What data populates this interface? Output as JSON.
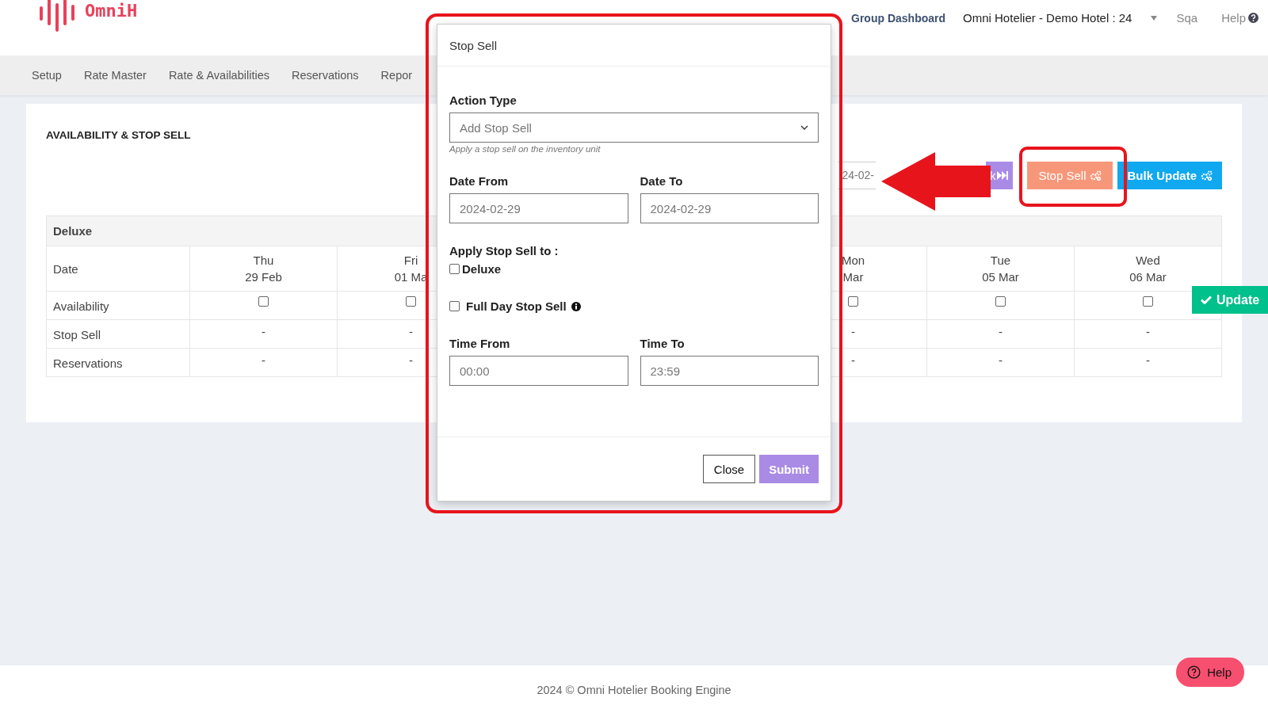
{
  "header": {
    "logo": "OmniH",
    "dashboard_link": "Group Dashboard",
    "hotel": "Omni Hotelier - Demo Hotel : 24",
    "user": "Sqa",
    "help": "Help"
  },
  "nav": [
    {
      "label": "Setup"
    },
    {
      "label": "Rate Master"
    },
    {
      "label": "Rate & Availabilities"
    },
    {
      "label": "Reservations"
    },
    {
      "label": "Repor"
    }
  ],
  "section_title": "AVAILABILITY & STOP SELL",
  "toolbar": {
    "date_value": "24-02-",
    "buttons": [
      {
        "label": "k",
        "kind": "next"
      },
      {
        "label": "Stop Sell",
        "kind": "stop"
      },
      {
        "label": "Bulk Update",
        "kind": "bulk"
      }
    ]
  },
  "table": {
    "room": "Deluxe",
    "date_label": "Date",
    "columns": [
      {
        "day": "Thu",
        "date": "29 Feb"
      },
      {
        "day": "Fri",
        "date": "01 Ma"
      },
      {
        "day": "Mon",
        "date": "Mar"
      },
      {
        "day": "Tue",
        "date": "05 Mar"
      },
      {
        "day": "Wed",
        "date": "06 Mar"
      }
    ],
    "rows": [
      {
        "label": "Availability",
        "kind": "checkbox",
        "cells": [
          {
            "checked": false
          },
          {
            "checked": false
          },
          {
            "checked": false
          },
          {
            "checked": false
          },
          {
            "checked": false
          }
        ]
      },
      {
        "label": "Stop Sell",
        "kind": "text",
        "cells": [
          {
            "text": "-"
          },
          {
            "text": "-"
          },
          {
            "text": "-"
          },
          {
            "text": "-"
          },
          {
            "text": "-"
          }
        ]
      },
      {
        "label": "Reservations",
        "kind": "text",
        "cells": [
          {
            "text": "-"
          },
          {
            "text": "-"
          },
          {
            "text": "-"
          },
          {
            "text": "-"
          },
          {
            "text": "-"
          }
        ]
      }
    ]
  },
  "modal": {
    "title": "Stop Sell",
    "action_label": "Action Type",
    "action_value": "Add Stop Sell",
    "action_hint": "Apply a stop sell on the inventory unit",
    "date_from_label": "Date From",
    "date_from": "2024-02-29",
    "date_to_label": "Date To",
    "date_to": "2024-02-29",
    "apply_label": "Apply Stop Sell to :",
    "apply_options": [
      {
        "label": "Deluxe",
        "checked": false
      }
    ],
    "full_day": {
      "label": "Full Day Stop Sell",
      "checked": false
    },
    "time_from_label": "Time From",
    "time_from": "00:00",
    "time_to_label": "Time To",
    "time_to": "23:59",
    "buttons": [
      {
        "label": "Close",
        "kind": "secondary"
      },
      {
        "label": "Submit",
        "kind": "primary"
      }
    ]
  },
  "update_button": "Update",
  "help_button": "Help",
  "footer": "2024 © Omni Hotelier Booking Engine"
}
